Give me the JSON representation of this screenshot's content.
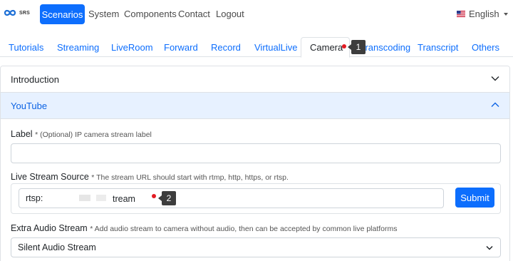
{
  "brand": {
    "logo_text": "SRS",
    "logo_icon": "srs-infinity-icon"
  },
  "navbar": {
    "active": "Scenarios",
    "links": [
      "System",
      "Components",
      "Contact",
      "Logout"
    ],
    "language": "English",
    "flag_icon": "us-flag-icon"
  },
  "tabs": {
    "items": [
      "Tutorials",
      "Streaming",
      "LiveRoom",
      "Forward",
      "Record",
      "VirtualLive",
      "Camera",
      "Transcoding",
      "Transcript",
      "Others"
    ],
    "active": "Camera"
  },
  "markers": {
    "first": "1",
    "second": "2"
  },
  "accordion": {
    "intro": {
      "title": "Introduction"
    },
    "youtube": {
      "title": "YouTube"
    }
  },
  "form": {
    "label": {
      "title": "Label",
      "hint": "* (Optional) IP camera stream label",
      "value": ""
    },
    "source": {
      "title": "Live Stream Source",
      "hint": "* The stream URL should start with rtmp, http, https, or rtsp.",
      "value_prefix": "rtsp:",
      "value_suffix": "tream",
      "submit": "Submit"
    },
    "audio": {
      "title": "Extra Audio Stream",
      "hint": "* Add audio stream to camera without audio, then can be accepted by common live platforms",
      "selected": "Silent Audio Stream"
    }
  },
  "colors": {
    "primary": "#0d6efd",
    "accordion_active_bg": "#e7f1ff",
    "marker_dot": "#e31b23"
  }
}
